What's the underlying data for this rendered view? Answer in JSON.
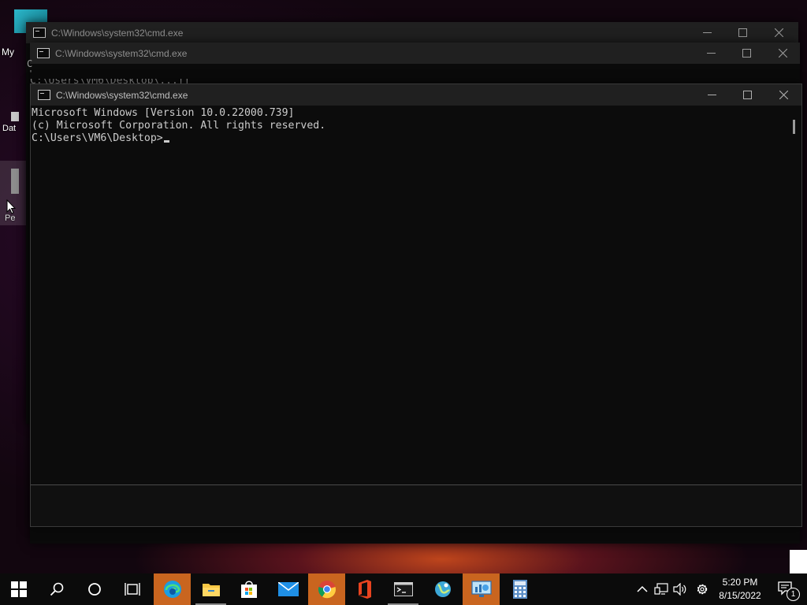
{
  "desktop": {
    "labels": {
      "my": "My",
      "dat": "Dat",
      "pe": "Pe"
    }
  },
  "windows": {
    "back": {
      "title": "C:\\Windows\\system32\\cmd.exe"
    },
    "middle": {
      "title": "C:\\Windows\\system32\\cmd.exe",
      "partial_line": "C:\\Users\\VM6\\Desktop\\...ff",
      "left_fragment_1": "C",
      "left_fragment_2": "'"
    },
    "front": {
      "title": "C:\\Windows\\system32\\cmd.exe",
      "console_lines": [
        "Microsoft Windows [Version 10.0.22000.739]",
        "(c) Microsoft Corporation. All rights reserved.",
        "",
        "C:\\Users\\VM6\\Desktop>"
      ]
    }
  },
  "taskbar": {
    "apps": [
      {
        "name": "start",
        "icon": "windows-logo-icon"
      },
      {
        "name": "search",
        "icon": "search-icon"
      },
      {
        "name": "cortana",
        "icon": "circle-icon"
      },
      {
        "name": "task-view",
        "icon": "task-view-icon"
      },
      {
        "name": "edge",
        "icon": "edge-icon",
        "active": true
      },
      {
        "name": "file-explorer",
        "icon": "folder-icon"
      },
      {
        "name": "store",
        "icon": "store-bag-icon"
      },
      {
        "name": "mail",
        "icon": "mail-icon"
      },
      {
        "name": "chrome",
        "icon": "chrome-icon",
        "active": true
      },
      {
        "name": "office",
        "icon": "office-icon"
      },
      {
        "name": "terminal",
        "icon": "terminal-icon",
        "running": true
      },
      {
        "name": "maps",
        "icon": "globe-icon"
      },
      {
        "name": "control-panel",
        "icon": "monitor-chart-icon",
        "active": true
      },
      {
        "name": "calculator",
        "icon": "calculator-icon"
      }
    ],
    "tray": {
      "time": "5:20 PM",
      "date": "8/15/2022",
      "notification_count": "1"
    }
  },
  "colors": {
    "console_bg": "#0c0c0c",
    "console_text": "#cccccc",
    "titlebar": "#202020",
    "taskbar_highlight": "#c9651f"
  }
}
